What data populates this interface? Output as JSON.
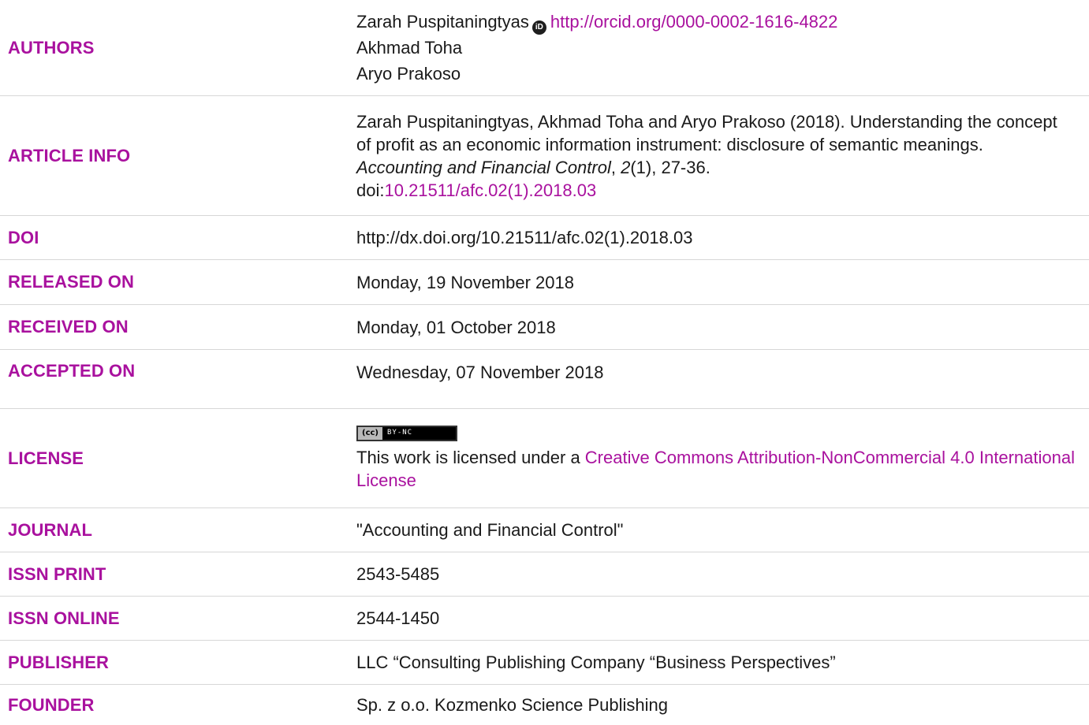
{
  "authors": {
    "label": "AUTHORS",
    "list": [
      {
        "name": "Zarah Puspitaningtyas",
        "orcid_icon": "iD",
        "orcid_url": "http://orcid.org/0000-0002-1616-4822"
      },
      {
        "name": "Akhmad Toha"
      },
      {
        "name": "Aryo Prakoso"
      }
    ]
  },
  "article_info": {
    "label": "ARTICLE INFO",
    "citation_authors": "Zarah Puspitaningtyas, Akhmad Toha and Aryo Prakoso (2018). Understanding the concept of profit as an economic information instrument: disclosure of semantic meanings. ",
    "journal_italic": "Accounting and Financial Control",
    "comma1": ", ",
    "volume_italic": "2",
    "issue_pages": "(1), 27-36.",
    "doi_prefix": "doi:",
    "doi_link": "10.21511/afc.02(1).2018.03"
  },
  "doi": {
    "label": "DOI",
    "value": "http://dx.doi.org/10.21511/afc.02(1).2018.03"
  },
  "released": {
    "label": "RELEASED ON",
    "value": "Monday, 19 November 2018"
  },
  "received": {
    "label": "RECEIVED ON",
    "value": "Monday, 01 October 2018"
  },
  "accepted": {
    "label": "ACCEPTED ON",
    "value": "Wednesday, 07 November 2018"
  },
  "license": {
    "label": "LICENSE",
    "badge_cc": "(cc)",
    "badge_by": "BY-NC",
    "text": "This work is licensed under a ",
    "link": "Creative Commons Attribution-NonCommercial 4.0 International License"
  },
  "journal": {
    "label": "JOURNAL",
    "value": "\"Accounting and Financial Control\""
  },
  "issn_print": {
    "label": "ISSN PRINT",
    "value": "2543-5485"
  },
  "issn_online": {
    "label": "ISSN ONLINE",
    "value": "2544-1450"
  },
  "publisher": {
    "label": "PUBLISHER",
    "value": "LLC “Consulting Publishing Company “Business Perspectives”"
  },
  "founder": {
    "label": "FOUNDER",
    "value": "Sp. z o.o. Kozmenko Science Publishing"
  },
  "colors": {
    "accent": "#a9119e",
    "text": "#1a1a1a",
    "divider": "#d7d7d7"
  }
}
